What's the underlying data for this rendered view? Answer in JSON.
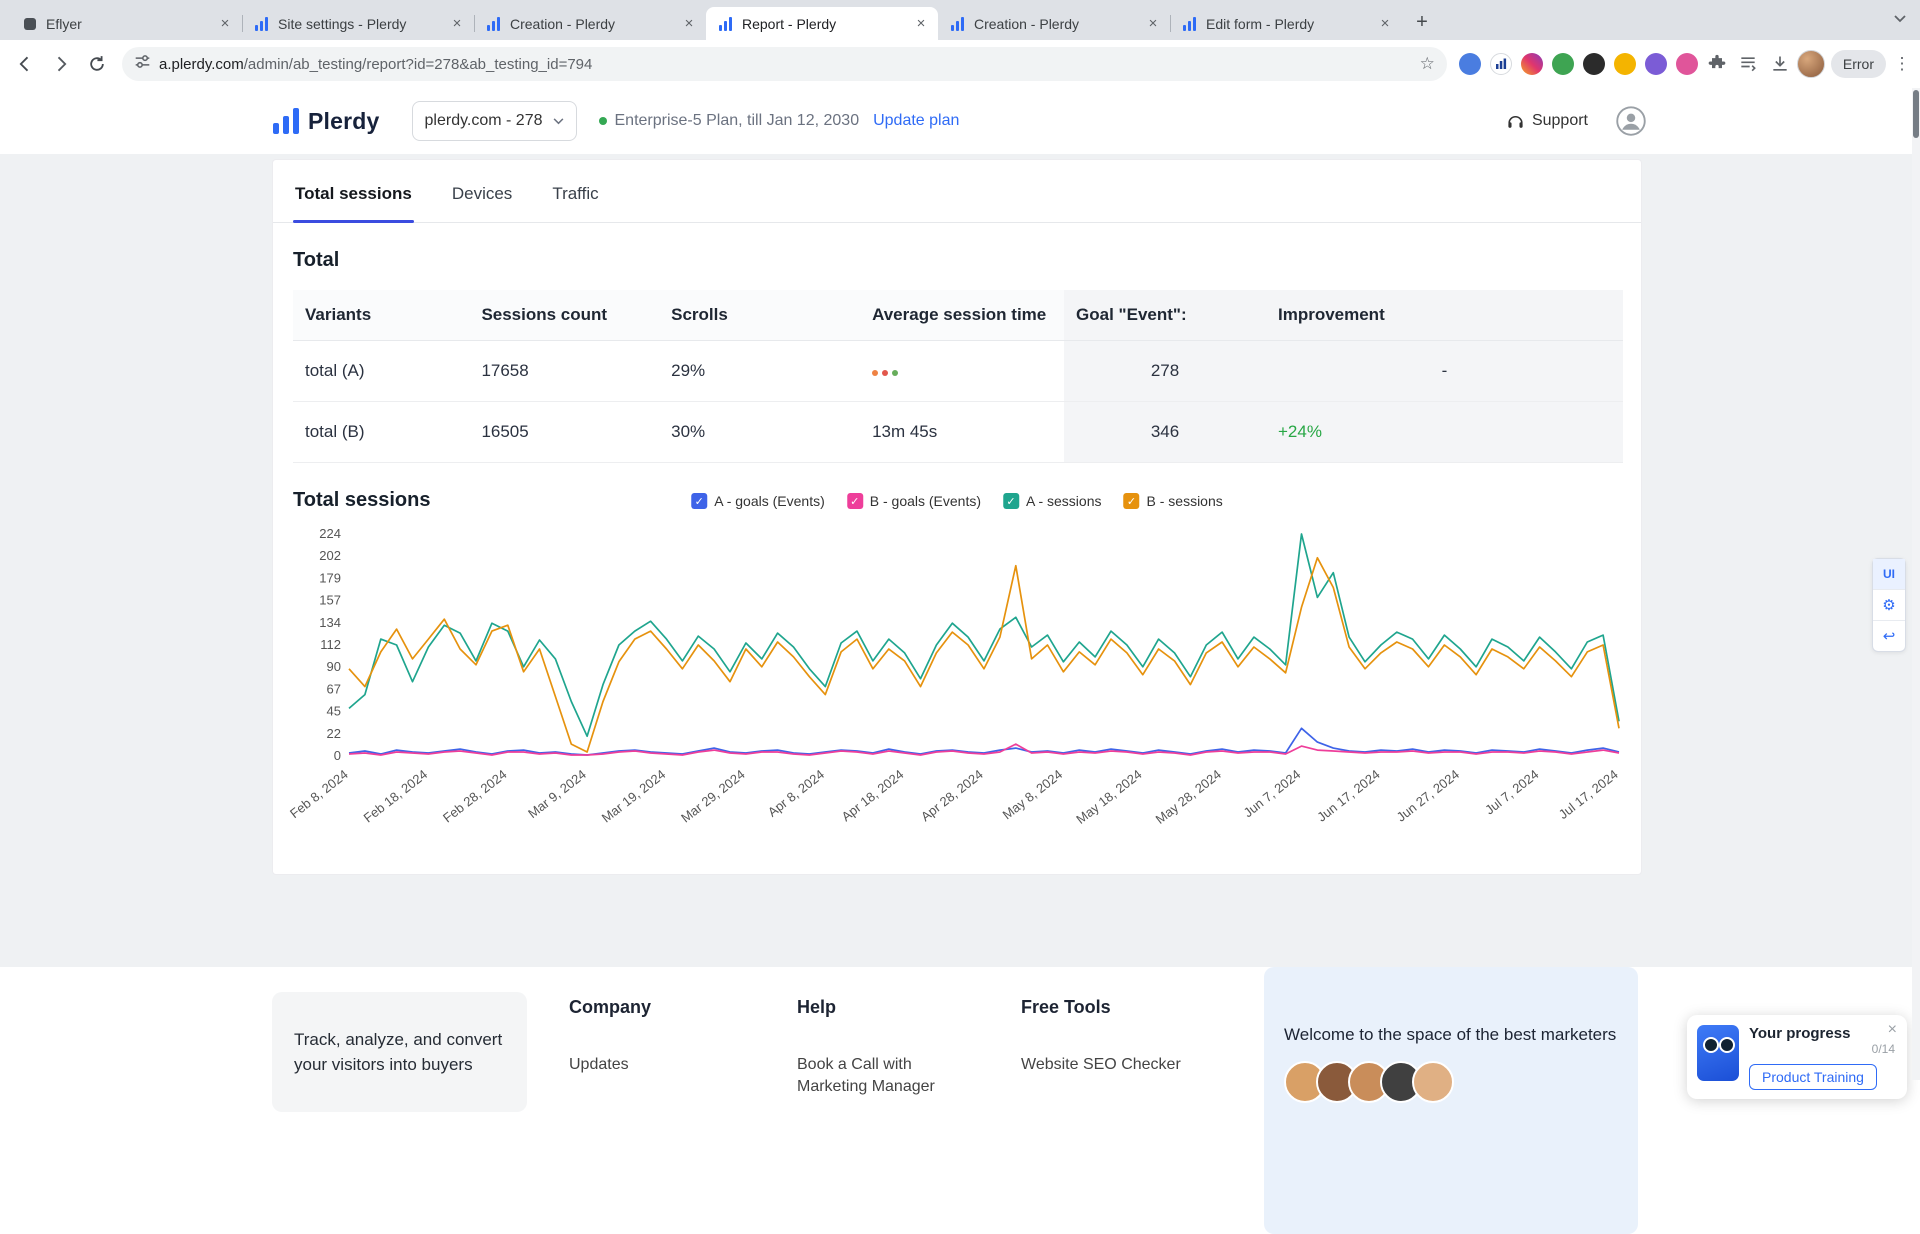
{
  "browser": {
    "tabs": [
      {
        "title": "Eflyer"
      },
      {
        "title": "Site settings - Plerdy"
      },
      {
        "title": "Creation - Plerdy"
      },
      {
        "title": "Report - Plerdy"
      },
      {
        "title": "Creation - Plerdy"
      },
      {
        "title": "Edit form - Plerdy"
      }
    ],
    "active_tab_index": 3,
    "url_domain": "a.plerdy.com",
    "url_path": "/admin/ab_testing/report?id=278&ab_testing_id=794",
    "error_label": "Error"
  },
  "header": {
    "brand": "Plerdy",
    "domain_selector": "plerdy.com - 278",
    "plan_text": "Enterprise-5 Plan, till Jan 12, 2030",
    "update_plan": "Update plan",
    "support": "Support"
  },
  "page_tabs": {
    "items": [
      "Total sessions",
      "Devices",
      "Traffic"
    ],
    "active": "Total sessions"
  },
  "total_section": {
    "title": "Total",
    "headers": [
      "Variants",
      "Sessions count",
      "Scrolls",
      "Average session time",
      "Goal \"Event\":",
      "Improvement"
    ],
    "rows": [
      {
        "variant": "total (A)",
        "sessions": "17658",
        "scrolls": "29%",
        "avg_time": "",
        "goal": "278",
        "improvement": "-"
      },
      {
        "variant": "total (B)",
        "sessions": "16505",
        "scrolls": "30%",
        "avg_time": "13m 45s",
        "goal": "346",
        "improvement": "+24%"
      }
    ]
  },
  "sessions_section": {
    "title": "Total sessions"
  },
  "chart_data": {
    "type": "line",
    "title": "Total sessions",
    "grid": false,
    "legend_position": "top-center",
    "ylim": [
      0,
      224
    ],
    "yticks": [
      224,
      202,
      179,
      157,
      134,
      112,
      90,
      67,
      45,
      22,
      0
    ],
    "x_tick_every": 5,
    "x_tick_labels": [
      "Feb 8, 2024",
      "Feb 18, 2024",
      "Feb 28, 2024",
      "Mar 9, 2024",
      "Mar 19, 2024",
      "Mar 29, 2024",
      "Apr 8, 2024",
      "Apr 18, 2024",
      "Apr 28, 2024",
      "May 8, 2024",
      "May 18, 2024",
      "May 28, 2024",
      "Jun 7, 2024",
      "Jun 17, 2024",
      "Jun 27, 2024",
      "Jul 7, 2024",
      "Jul 17, 2024"
    ],
    "series": [
      {
        "name": "A - goals (Events)",
        "color": "#3e63e8",
        "values": [
          3,
          5,
          2,
          6,
          4,
          3,
          5,
          7,
          4,
          2,
          5,
          6,
          3,
          4,
          2,
          1,
          3,
          5,
          6,
          4,
          3,
          2,
          5,
          8,
          4,
          3,
          5,
          6,
          3,
          2,
          4,
          6,
          5,
          3,
          7,
          4,
          2,
          5,
          6,
          4,
          3,
          6,
          8,
          4,
          5,
          3,
          6,
          4,
          7,
          5,
          3,
          6,
          4,
          2,
          5,
          7,
          4,
          6,
          5,
          3,
          28,
          14,
          8,
          5,
          4,
          6,
          5,
          7,
          4,
          6,
          5,
          3,
          6,
          5,
          4,
          7,
          5,
          3,
          6,
          8,
          4
        ]
      },
      {
        "name": "B - goals (Events)",
        "color": "#ee3e9a",
        "values": [
          2,
          3,
          1,
          4,
          3,
          2,
          4,
          5,
          3,
          1,
          4,
          4,
          2,
          3,
          1,
          1,
          2,
          4,
          5,
          3,
          2,
          1,
          4,
          6,
          3,
          2,
          4,
          4,
          2,
          1,
          3,
          5,
          4,
          2,
          5,
          3,
          1,
          4,
          5,
          3,
          2,
          4,
          12,
          3,
          4,
          2,
          4,
          3,
          5,
          4,
          2,
          4,
          3,
          1,
          4,
          5,
          3,
          4,
          4,
          2,
          10,
          6,
          5,
          4,
          3,
          4,
          4,
          5,
          3,
          4,
          4,
          2,
          4,
          4,
          3,
          5,
          4,
          2,
          4,
          6,
          3
        ]
      },
      {
        "name": "A - sessions",
        "color": "#1fa58e",
        "values": [
          48,
          62,
          118,
          112,
          75,
          110,
          132,
          124,
          96,
          134,
          126,
          90,
          117,
          98,
          55,
          20,
          72,
          112,
          126,
          136,
          118,
          96,
          121,
          108,
          85,
          114,
          98,
          124,
          110,
          88,
          70,
          114,
          126,
          96,
          118,
          104,
          78,
          112,
          134,
          120,
          96,
          128,
          140,
          110,
          122,
          95,
          115,
          100,
          126,
          112,
          90,
          118,
          104,
          80,
          112,
          125,
          98,
          120,
          108,
          92,
          224,
          160,
          185,
          120,
          95,
          112,
          125,
          118,
          98,
          122,
          108,
          90,
          118,
          110,
          96,
          120,
          105,
          88,
          115,
          122,
          35
        ]
      },
      {
        "name": "B - sessions",
        "color": "#e6920e",
        "values": [
          88,
          70,
          105,
          128,
          98,
          118,
          138,
          108,
          92,
          126,
          132,
          85,
          108,
          60,
          12,
          4,
          55,
          95,
          118,
          126,
          108,
          88,
          112,
          96,
          75,
          108,
          90,
          115,
          100,
          80,
          62,
          105,
          118,
          88,
          108,
          96,
          70,
          104,
          125,
          112,
          88,
          120,
          192,
          98,
          112,
          85,
          105,
          92,
          118,
          104,
          82,
          108,
          96,
          72,
          104,
          115,
          90,
          110,
          98,
          84,
          150,
          200,
          170,
          110,
          88,
          104,
          115,
          108,
          90,
          112,
          100,
          82,
          108,
          100,
          88,
          110,
          96,
          80,
          105,
          112,
          28
        ]
      }
    ]
  },
  "side_tools": {
    "ui_label": "UI"
  },
  "progress_card": {
    "title": "Your progress",
    "count": "0/14",
    "button": "Product Training"
  },
  "footer": {
    "tagline": "Track, analyze, and convert your visitors into buyers",
    "columns": [
      {
        "title": "Company",
        "links": [
          "Updates"
        ]
      },
      {
        "title": "Help",
        "links": [
          "Book a Call with Marketing Manager"
        ]
      },
      {
        "title": "Free Tools",
        "links": [
          "Website SEO Checker"
        ]
      }
    ],
    "community": "Welcome to the space of the best marketers"
  },
  "colors": {
    "accent_blue": "#2f6bf6",
    "positive_green": "#28a745",
    "active_tab_underline": "#3b4ce0"
  }
}
